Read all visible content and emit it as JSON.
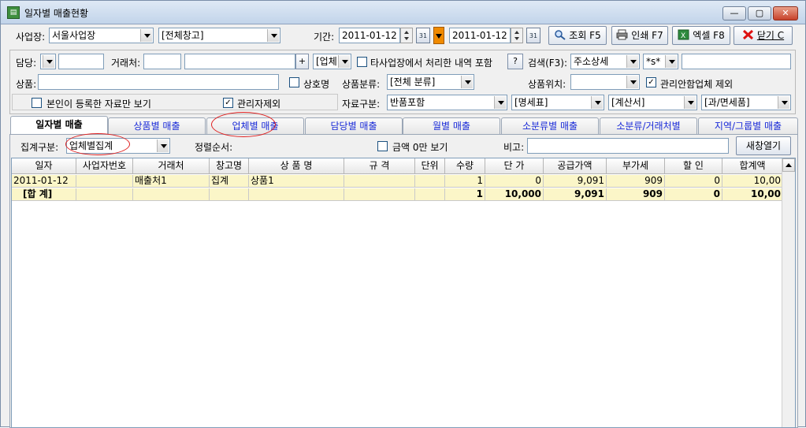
{
  "window": {
    "title": "일자별 매출현황",
    "minimize": "—",
    "maximize": "▢",
    "close": "✕"
  },
  "toolbar": {
    "branch_label": "사업장:",
    "branch_value": "서울사업장",
    "warehouse_value": "[전체창고]",
    "period_label": "기간:",
    "date_from": "2011-01-12",
    "date_to": "2011-01-12",
    "calendar_icon_text": "31",
    "search_button": "조회 F5",
    "print_button": "인쇄 F7",
    "excel_button": "엑셀 F8",
    "close_button": "닫기 C"
  },
  "filters": {
    "manager_label": "담당:",
    "manager_value": "",
    "customer_label": "거래처:",
    "customer_code": "",
    "customer_name": "",
    "plus_button": "+",
    "biz_combo": "[업체",
    "other_branch_label": "타사업장에서 처리한 내역 포함",
    "question_button": "?",
    "search_label": "검색(F3):",
    "search_type": "주소상세",
    "wildcard": "*s*",
    "search_value": "",
    "product_label": "상품:",
    "product_value": "",
    "trade_name_label": "상호명",
    "product_class_label": "상품분류:",
    "product_class_value": "[전체 분류]",
    "product_location_label": "상품위치:",
    "product_location_value": "",
    "exclude_unmanaged_label": "관리안함업체 제외",
    "own_only_label": "본인이 등록한 자료만 보기",
    "exclude_admin_label": "관리자제외",
    "data_type_label": "자료구분:",
    "data_type_value": "반품포함",
    "statement_value": "[명세표]",
    "invoice_value": "[계산서]",
    "tax_value": "[과/면세품]"
  },
  "tabs": [
    {
      "label": "일자별 매출",
      "active": true
    },
    {
      "label": "상품별 매출",
      "active": false
    },
    {
      "label": "업체별 매출",
      "active": false
    },
    {
      "label": "담당별 매출",
      "active": false
    },
    {
      "label": "월별 매출",
      "active": false
    },
    {
      "label": "소분류별 매출",
      "active": false
    },
    {
      "label": "소분류/거래처별",
      "active": false
    },
    {
      "label": "지역/그룹별 매출",
      "active": false
    }
  ],
  "options": {
    "group_label": "집계구분:",
    "group_value": "업체별집계",
    "sort_label": "정렬순서:",
    "hide_small_label": "금액 0만 보기",
    "note_label": "비고:",
    "note_value": "",
    "new_window_button": "새창열기"
  },
  "grid": {
    "headers": [
      "일자",
      "사업자번호",
      "거래처",
      "창고명",
      "상 품 명",
      "규 격",
      "단위",
      "수량",
      "단 가",
      "공급가액",
      "부가세",
      "할 인",
      "합계액"
    ],
    "rows": [
      [
        "2011-01-12",
        "",
        "매출처1",
        "집계",
        "상품1",
        "",
        "",
        "1",
        "0",
        "9,091",
        "909",
        "0",
        "10,00"
      ],
      [
        "[합 계]",
        "",
        "",
        "",
        "",
        "",
        "",
        "1",
        "10,000",
        "9,091",
        "909",
        "0",
        "10,00"
      ]
    ]
  },
  "colors": {
    "selected_row": "#fbf6c8",
    "tab_text": "#1a2bd8",
    "annotation": "#e02020"
  }
}
